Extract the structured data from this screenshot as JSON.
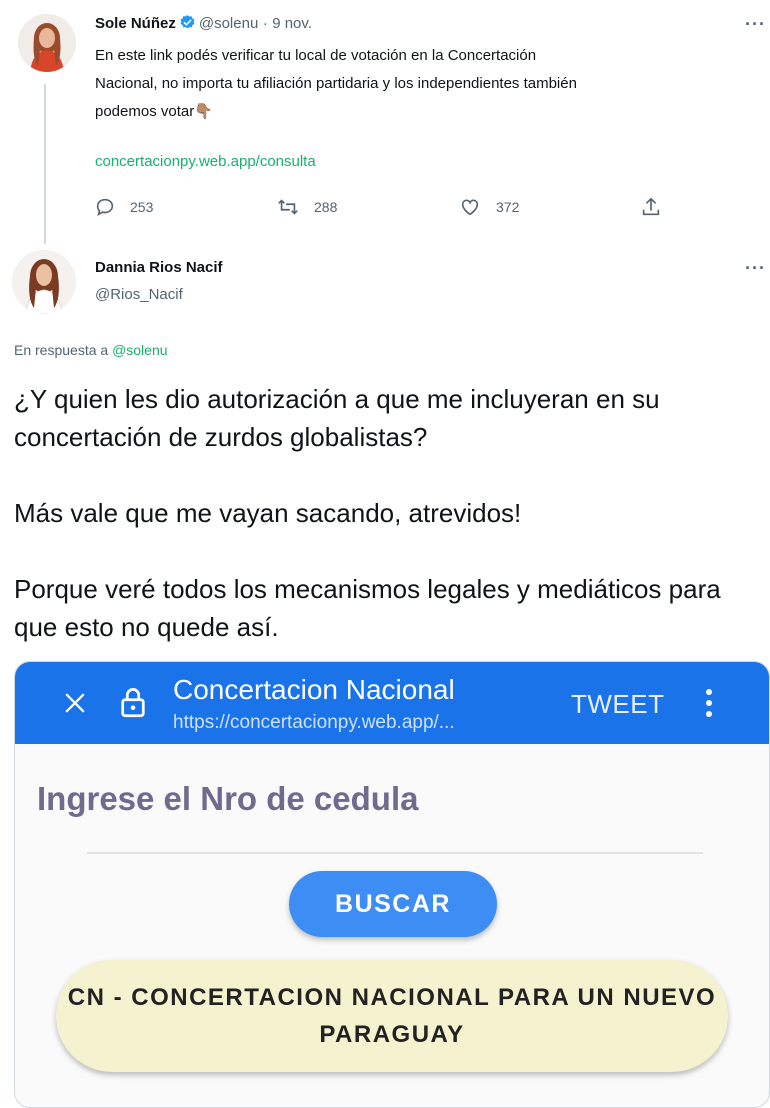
{
  "parent_tweet": {
    "author_name": "Sole Núñez",
    "handle": "@solenu",
    "separator": "·",
    "date": "9 nov.",
    "more_label": "···",
    "text_lines": [
      "En este link podés verificar tu local de votación en la Concertación",
      "Nacional, no importa tu afiliación partidaria y los independientes también",
      "podemos votar"
    ],
    "emoji": "👇🏽",
    "link": "concertacionpy.web.app/consulta",
    "actions": {
      "replies": "253",
      "retweets": "288",
      "likes": "372"
    },
    "accent": "#1d9bf0",
    "link_color": "#17b26a"
  },
  "reply_tweet": {
    "author_name": "Dannia Rios Nacif",
    "handle": "@Rios_Nacif",
    "more_label": "···",
    "reply_prefix": "En respuesta a",
    "reply_mention": "@solenu",
    "paragraphs": [
      "¿Y quien les dio autorización a que me incluyeran en su concertación de zurdos globalistas?",
      "Más vale que me vayan sacando, atrevidos!",
      "Porque veré todos los mecanismos legales y mediáticos para que esto no quede así."
    ]
  },
  "embedded_screenshot": {
    "app_title": "Concertacion Nacional",
    "url": "https://concertacionpy.web.app/...",
    "tweet_button": "TWEET",
    "heading": "Ingrese el Nro de cedula",
    "search_button": "BUSCAR",
    "party_name": "CN - CONCERTACION NACIONAL PARA UN NUEVO PARAGUAY",
    "appbar_color": "#1a73e8",
    "button_color": "#3d8df5",
    "party_bg": "#f5f2d0"
  },
  "icons": [
    "close-icon",
    "lock-icon",
    "kebab-menu-icon",
    "reply-icon",
    "retweet-icon",
    "like-icon",
    "share-icon",
    "verified-badge-icon"
  ]
}
